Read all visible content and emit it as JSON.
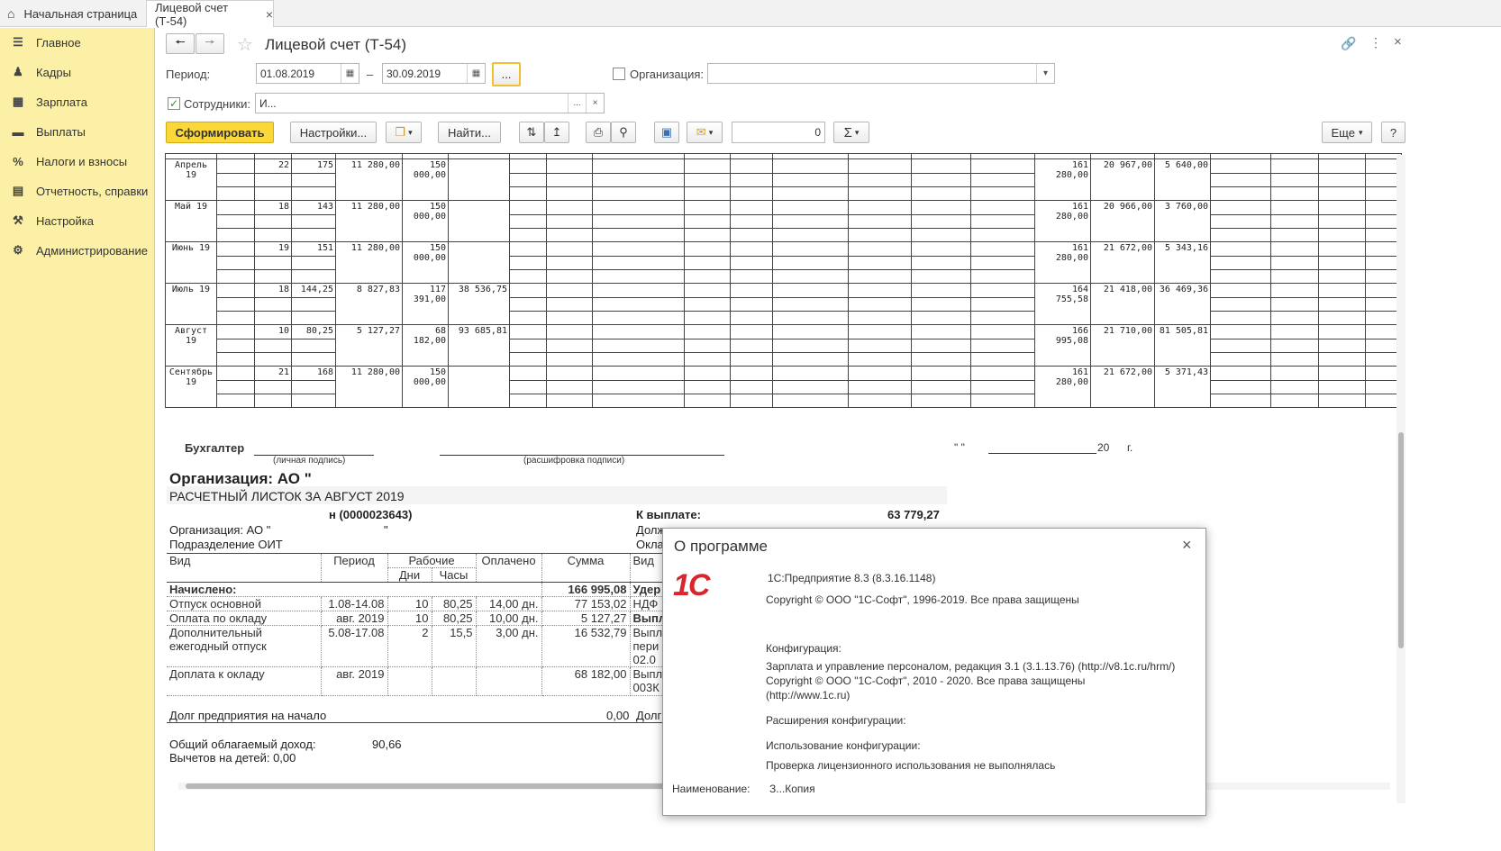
{
  "tabs": {
    "home_label": "Начальная страница",
    "active_label": "Лицевой счет (Т-54)",
    "close_symbol": "×"
  },
  "sidebar": {
    "items": [
      {
        "label": "Главное",
        "icon": "menu-icon"
      },
      {
        "label": "Кадры",
        "icon": "people-icon"
      },
      {
        "label": "Зарплата",
        "icon": "calculator-icon"
      },
      {
        "label": "Выплаты",
        "icon": "wallet-icon"
      },
      {
        "label": "Налоги и взносы",
        "icon": "percent-icon"
      },
      {
        "label": "Отчетность, справки",
        "icon": "report-icon"
      },
      {
        "label": "Настройка",
        "icon": "wrench-icon"
      },
      {
        "label": "Администрирование",
        "icon": "gear-icon"
      }
    ]
  },
  "form": {
    "title": "Лицевой счет (Т-54)",
    "period_label": "Период:",
    "date_from": "01.08.2019",
    "date_sep": "–",
    "date_to": "30.09.2019",
    "period_btn": "...",
    "org_label": "Организация:",
    "org_value": "",
    "employees_label": "Сотрудники:",
    "employees_value": "И...",
    "toolbar": {
      "generate": "Сформировать",
      "settings": "Настройки...",
      "find": "Найти...",
      "counter": "0",
      "sum_symbol": "Σ",
      "more": "Еще",
      "help": "?"
    }
  },
  "report": {
    "rows": [
      {
        "month": "Апрель 19",
        "c2": "22",
        "c3": "175",
        "c4": "11 280,00",
        "c5": "150 000,00",
        "c6": "",
        "c16": "161 280,00",
        "c17": "20 967,00",
        "c18": "5 640,00"
      },
      {
        "month": "Май 19",
        "c2": "18",
        "c3": "143",
        "c4": "11 280,00",
        "c5": "150 000,00",
        "c6": "",
        "c16": "161 280,00",
        "c17": "20 966,00",
        "c18": "3 760,00"
      },
      {
        "month": "Июнь 19",
        "c2": "19",
        "c3": "151",
        "c4": "11 280,00",
        "c5": "150 000,00",
        "c6": "",
        "c16": "161 280,00",
        "c17": "21 672,00",
        "c18": "5 343,16"
      },
      {
        "month": "Июль 19",
        "c2": "18",
        "c3": "144,25",
        "c4": "8 827,83",
        "c5": "117 391,00",
        "c6": "38 536,75",
        "c16": "164 755,58",
        "c17": "21 418,00",
        "c18": "36 469,36"
      },
      {
        "month": "Август 19",
        "c2": "10",
        "c3": "80,25",
        "c4": "5 127,27",
        "c5": "68 182,00",
        "c6": "93 685,81",
        "c16": "166 995,08",
        "c17": "21 710,00",
        "c18": "81 505,81"
      },
      {
        "month": "Сентябрь 19",
        "c2": "21",
        "c3": "168",
        "c4": "11 280,00",
        "c5": "150 000,00",
        "c6": "",
        "c16": "161 280,00",
        "c17": "21 672,00",
        "c18": "5 371,43"
      }
    ],
    "accountant_label": "Бухгалтер",
    "sign_hint": "(личная подпись)",
    "decode_hint": "(расшифровка подписи)",
    "date_quote": "\"     \"",
    "year_prefix": "20",
    "year_suffix": "г."
  },
  "payslip": {
    "org_heading": "Организация: АО \"",
    "title": "РАСЧЕТНЫЙ ЛИСТОК ЗА АВГУСТ 2019",
    "employee": "н (0000023643)",
    "to_pay_label": "К выплате:",
    "to_pay_value": "63 779,27",
    "org_line": "Организация:   АО \"",
    "org_line_end": "\"",
    "dept_line": "Подразделение ОИТ",
    "right_col_1": "Долж",
    "right_col_2": "Окла",
    "headers": {
      "kind": "Вид",
      "period": "Период",
      "working": "Рабочие",
      "days": "Дни",
      "hours": "Часы",
      "paid": "Оплачено",
      "sum": "Сумма",
      "kind2": "Вид"
    },
    "accrued_label": "Начислено:",
    "accrued_total": "166 995,08",
    "deduction_label": "Удер",
    "lines": [
      {
        "kind": "Отпуск основной",
        "period": "1.08-14.08",
        "days": "10",
        "hours": "80,25",
        "paid": "14,00 дн.",
        "sum": "77 153,02",
        "right": "НДФ"
      },
      {
        "kind": "Оплата по окладу",
        "period": "авг. 2019",
        "days": "10",
        "hours": "80,25",
        "paid": "10,00 дн.",
        "sum": "5 127,27",
        "right": "Выпл"
      },
      {
        "kind": "Дополнительный",
        "kind2": "ежегодный отпуск",
        "period": "5.08-17.08",
        "days": "2",
        "hours": "15,5",
        "paid": "3,00 дн.",
        "sum": "16 532,79",
        "right": "Выпл",
        "right2": "пери",
        "right3": "02.0"
      },
      {
        "kind": "Доплата к окладу",
        "period": "авг. 2019",
        "days": "",
        "hours": "",
        "paid": "",
        "sum": "68 182,00",
        "right": "Выпл",
        "right2": "003К"
      }
    ],
    "debt_label": "Долг предприятия на начало",
    "debt_value": "0,00",
    "debt_right": "Долг",
    "income_label": "Общий облагаемый доход:",
    "income_value": "90,66",
    "deductions_label": "Вычетов на детей: 0,00"
  },
  "about": {
    "title": "О программе",
    "close": "×",
    "logo": "1С",
    "product": "1С:Предприятие 8.3 (8.3.16.1148)",
    "copyright": "Copyright © ООО \"1С-Софт\", 1996-2019. Все права защищены",
    "config_label": "Конфигурация:",
    "config_line1": "Зарплата и управление персоналом, редакция 3.1 (3.1.13.76) (http://v8.1c.ru/hrm/)",
    "config_line2": "Copyright © ООО \"1С-Софт\", 2010 - 2020. Все права защищены",
    "config_line3": "(http://www.1c.ru)",
    "ext_label": "Расширения конфигурации:",
    "usage_label": "Использование конфигурации:",
    "usage_value": "Проверка лицензионного использования не выполнялась",
    "name_label": "Наименование:",
    "name_value": "З...Копия"
  },
  "colors": {
    "sidebar_bg": "#fbf0a6",
    "primary_btn": "#fbd739",
    "logo_red": "#d9262c"
  }
}
